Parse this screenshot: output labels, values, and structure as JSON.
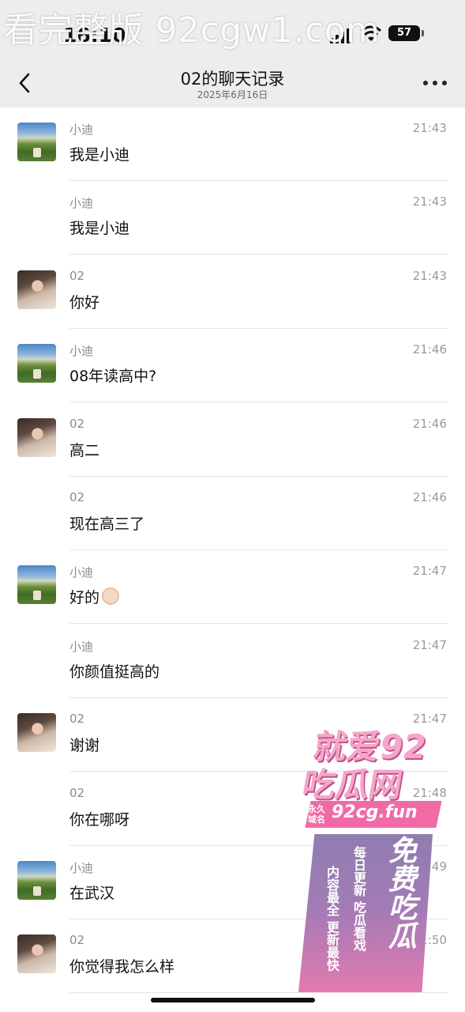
{
  "status_bar": {
    "time": "16:10",
    "battery": "57",
    "banner": "看完整版 92cgw1.com"
  },
  "nav": {
    "title": "02的聊天记录",
    "subtitle": "2025年6月16日"
  },
  "messages": [
    {
      "name": "小迪",
      "time": "21:43",
      "text": "我是小迪",
      "avatar": "landscape"
    },
    {
      "name": "小迪",
      "time": "21:43",
      "text": "我是小迪",
      "avatar": ""
    },
    {
      "name": "02",
      "time": "21:43",
      "text": "你好",
      "avatar": "portrait"
    },
    {
      "name": "小迪",
      "time": "21:46",
      "text": "08年读高中?",
      "avatar": "landscape"
    },
    {
      "name": "02",
      "time": "21:46",
      "text": "高二",
      "avatar": "portrait"
    },
    {
      "name": "02",
      "time": "21:46",
      "text": "现在高三了",
      "avatar": ""
    },
    {
      "name": "小迪",
      "time": "21:47",
      "text": "好的",
      "avatar": "landscape",
      "emoji": "ok-hand-emoji"
    },
    {
      "name": "小迪",
      "time": "21:47",
      "text": "你颜值挺高的",
      "avatar": ""
    },
    {
      "name": "02",
      "time": "21:47",
      "text": "谢谢",
      "avatar": "portrait"
    },
    {
      "name": "02",
      "time": "21:48",
      "text": "你在哪呀",
      "avatar": ""
    },
    {
      "name": "小迪",
      "time": "21:49",
      "text": "在武汉",
      "avatar": "landscape"
    },
    {
      "name": "02",
      "time": "21:50",
      "text": "你觉得我怎么样",
      "avatar": "portrait"
    }
  ],
  "ad": {
    "line1": "就爱92",
    "line2": "吃瓜网",
    "permanent": "永久域名",
    "domain": "92cg.fun",
    "slogan": "免费吃瓜",
    "tag1": "每日更新 吃瓜看戏",
    "tag2": "内容最全 更新最快"
  }
}
